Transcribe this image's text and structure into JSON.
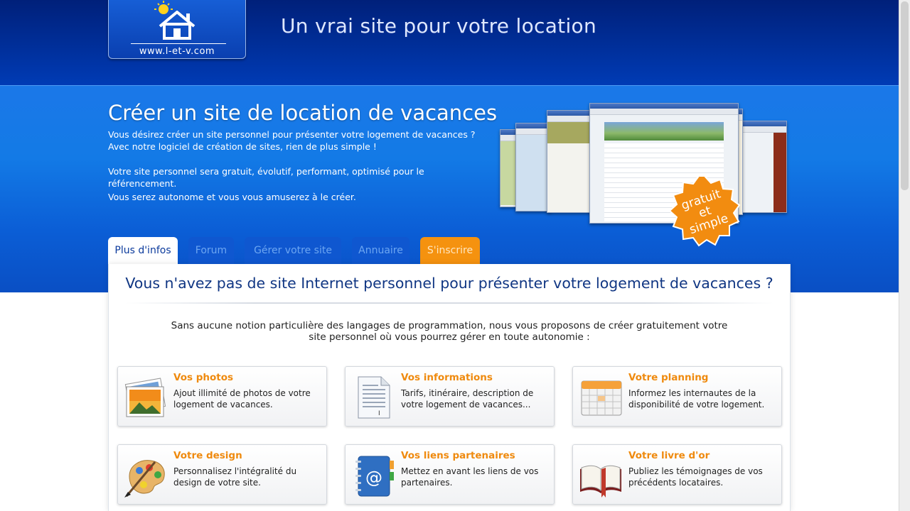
{
  "header": {
    "logo_url": "www.l-et-v.com",
    "tagline": "Un vrai site pour votre location"
  },
  "hero": {
    "title": "Créer un site de location de vacances",
    "paragraphs": [
      "Vous désirez créer un site personnel pour présenter votre logement de vacances ? Avec notre logiciel de création de sites, rien de plus simple !",
      "Votre site personnel sera gratuit, évolutif, performant, optimisé pour le référencement.",
      "Vous serez autonome et vous vous amuserez à le créer."
    ],
    "badge_lines": [
      "gratuit",
      "et",
      "simple"
    ]
  },
  "tabs": [
    {
      "label": "Plus d'infos"
    },
    {
      "label": "Forum"
    },
    {
      "label": "Gérer votre site"
    },
    {
      "label": "Annuaire"
    },
    {
      "label": "S'inscrire"
    }
  ],
  "main": {
    "title": "Vous n'avez pas de site Internet personnel pour présenter votre logement de vacances ?",
    "intro": "Sans aucune notion particulière des langages de programmation, nous vous proposons de créer gratuitement votre site personnel où vous pourrez gérer en toute autonomie :",
    "features": [
      {
        "title": "Vos photos",
        "desc": "Ajout illimité de photos de votre logement de vacances.",
        "icon": "photos-icon"
      },
      {
        "title": "Vos informations",
        "desc": "Tarifs, itinéraire, description de votre logement de vacances...",
        "icon": "document-icon"
      },
      {
        "title": "Votre planning",
        "desc": "Informez les internautes de la disponibilité de votre logement.",
        "icon": "calendar-icon"
      },
      {
        "title": "Votre design",
        "desc": "Personnalisez l'intégralité du design de votre site.",
        "icon": "palette-icon"
      },
      {
        "title": "Vos liens partenaires",
        "desc": "Mettez en avant les liens de vos partenaires.",
        "icon": "address-book-icon"
      },
      {
        "title": "Votre livre d'or",
        "desc": "Publiez les témoignages de vos précédents locataires.",
        "icon": "book-icon"
      }
    ]
  },
  "colors": {
    "primary": "#0b50c9",
    "accent": "#f5920f",
    "title": "#103683"
  }
}
